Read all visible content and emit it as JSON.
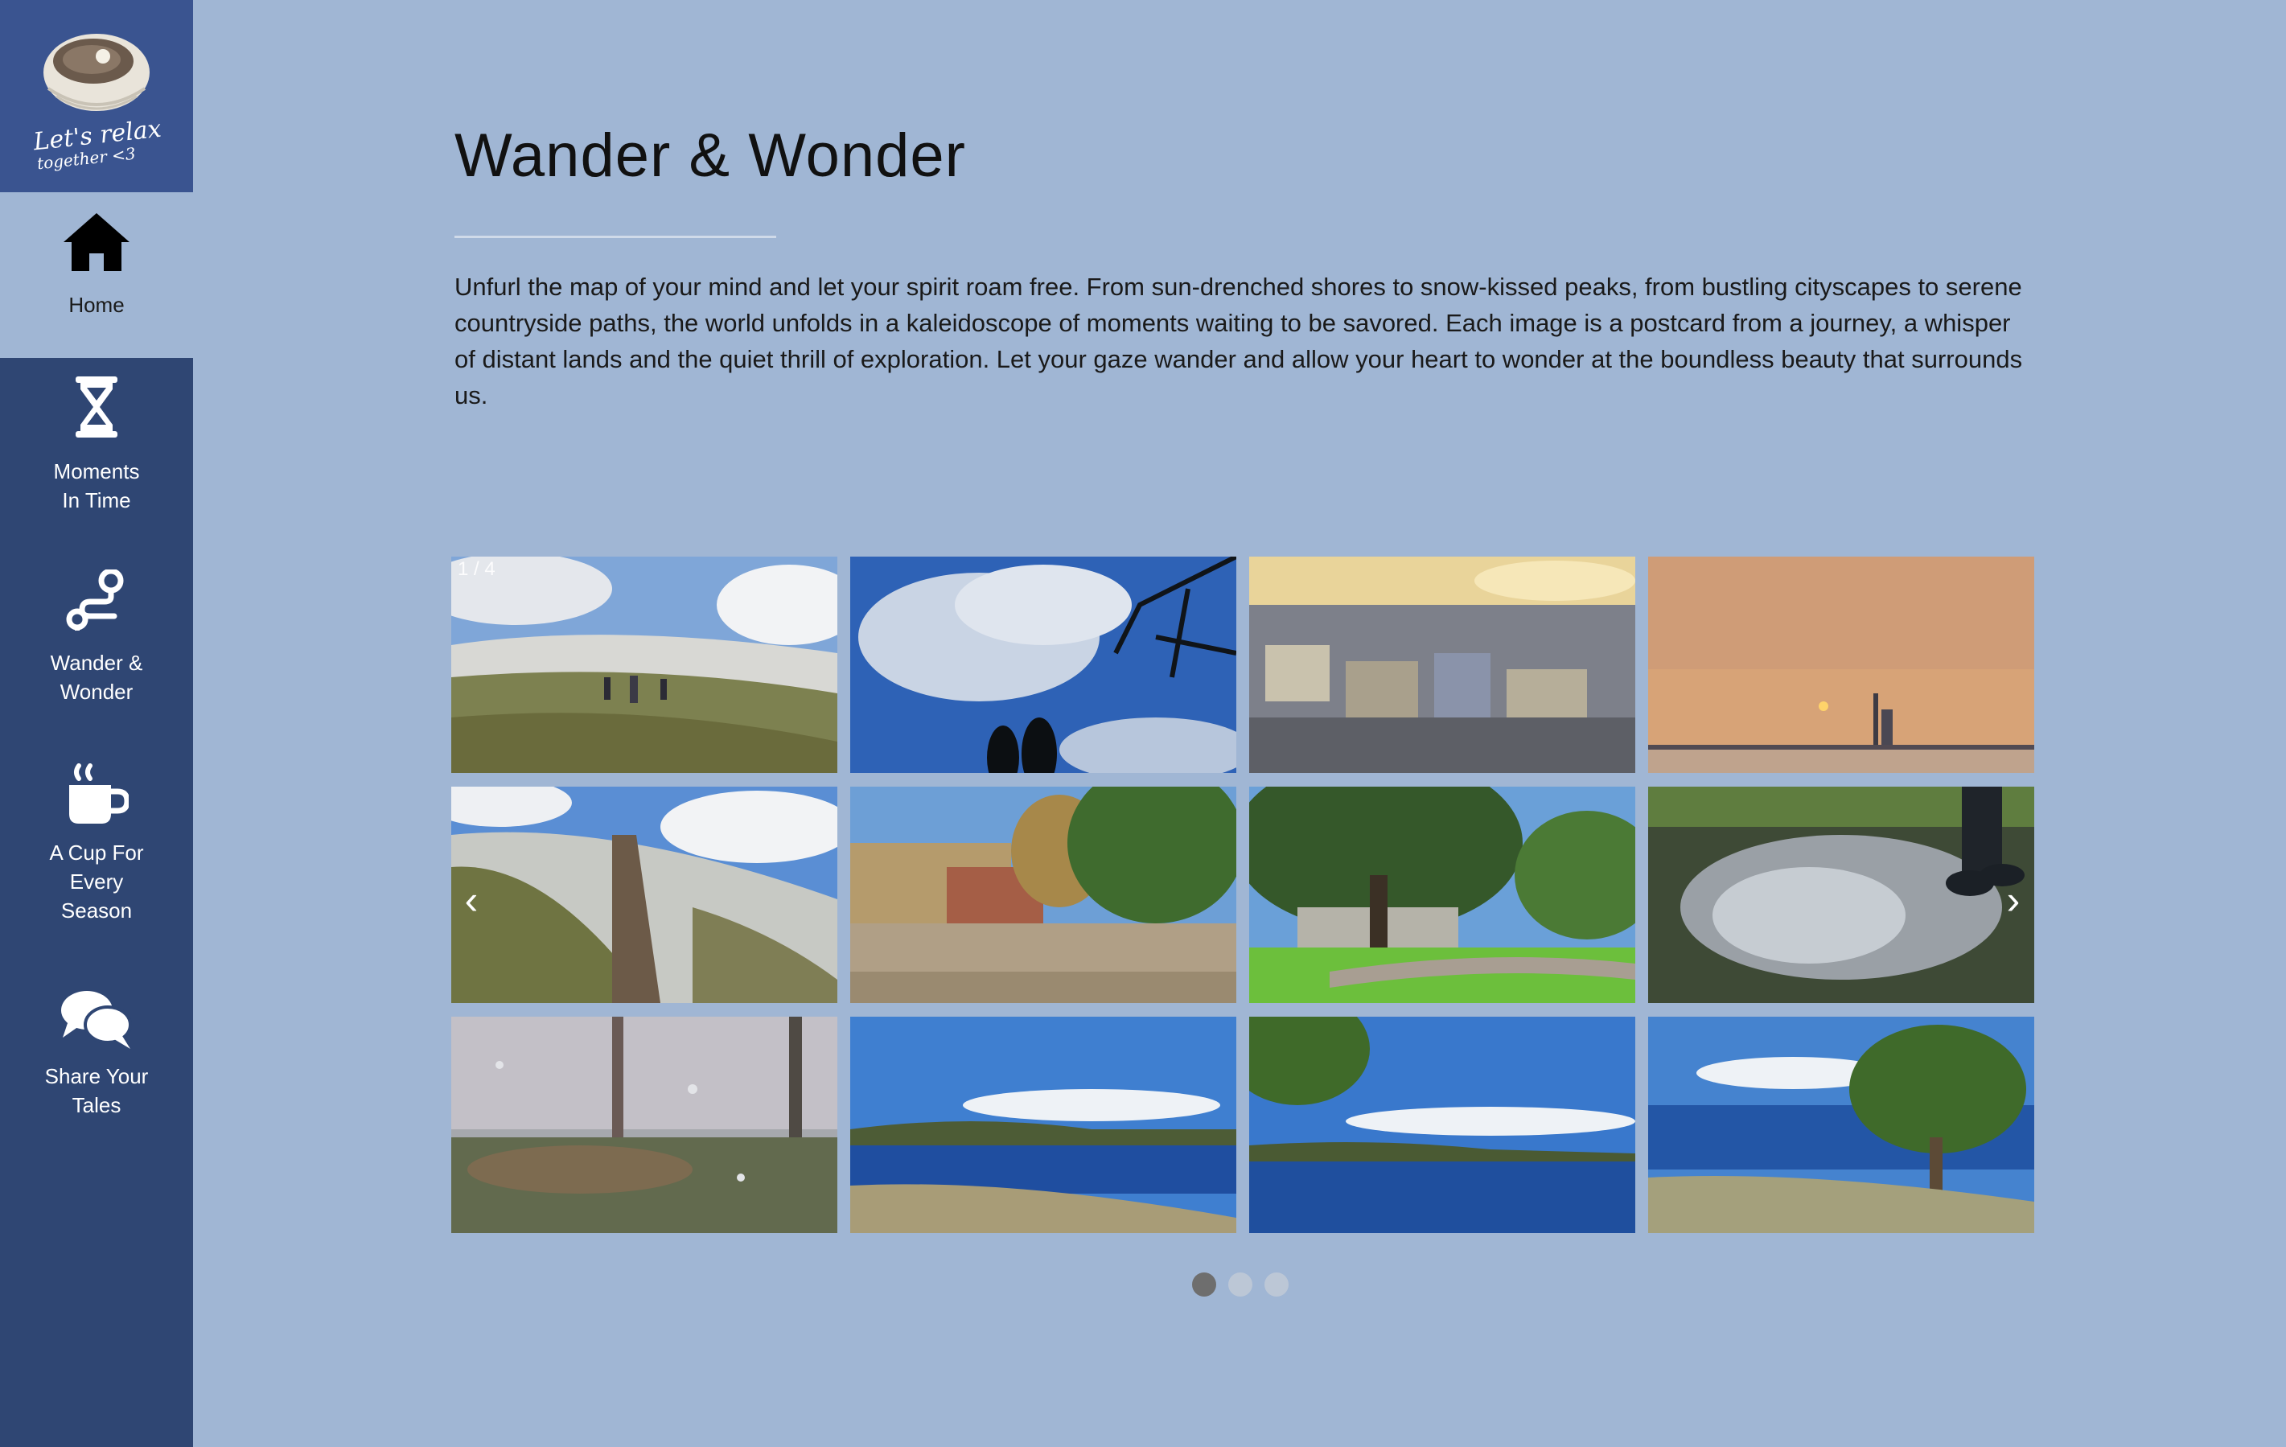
{
  "logo": {
    "line1": "Let's relax",
    "line2": "together <3"
  },
  "nav": [
    {
      "label_line1": "Home",
      "label_line2": "",
      "icon": "home-icon",
      "active": true
    },
    {
      "label_line1": "Moments",
      "label_line2": "In Time",
      "icon": "hourglass-icon",
      "active": false
    },
    {
      "label_line1": "Wander &",
      "label_line2": "Wonder",
      "icon": "route-icon",
      "active": false
    },
    {
      "label_line1": "A Cup For",
      "label_line2": "Every",
      "label_line3": "Season",
      "icon": "coffee-cup-icon",
      "active": false
    },
    {
      "label_line1": "Share Your",
      "label_line2": "Tales",
      "icon": "chat-bubbles-icon",
      "active": false
    }
  ],
  "page": {
    "title": "Wander & Wonder",
    "intro": "Unfurl the map of your mind and let your spirit roam free. From sun-drenched shores to snow-kissed peaks, from bustling cityscapes to serene countryside paths, the world unfolds in a kaleidoscope of moments waiting to be savored. Each image is a postcard from a journey, a whisper of distant lands and the quiet thrill of exploration. Let your gaze wander and allow your heart to wonder at the boundless beauty that surrounds us."
  },
  "gallery": {
    "counter": "1 / 4",
    "prev_label": "‹",
    "next_label": "›",
    "photos": [
      "hikers-on-snowy-hillside",
      "clouds-and-tree-silhouette",
      "city-rooftops-at-sunset",
      "hazy-sunset-over-water",
      "snowy-hill-path",
      "campus-lawn-with-geese",
      "park-with-large-tree",
      "pond-with-reeds-and-boots",
      "rain-on-window-forest",
      "lake-view-with-islands",
      "lake-view-through-trees",
      "lake-view-with-tree"
    ],
    "dots": 3,
    "active_dot": 0
  },
  "colors": {
    "background": "#a0b6d4",
    "sidebar": "#2f4673",
    "logo_block": "#3a5490",
    "dot_active": "#6e6e6e",
    "dot_inactive": "#bcc7d6"
  }
}
